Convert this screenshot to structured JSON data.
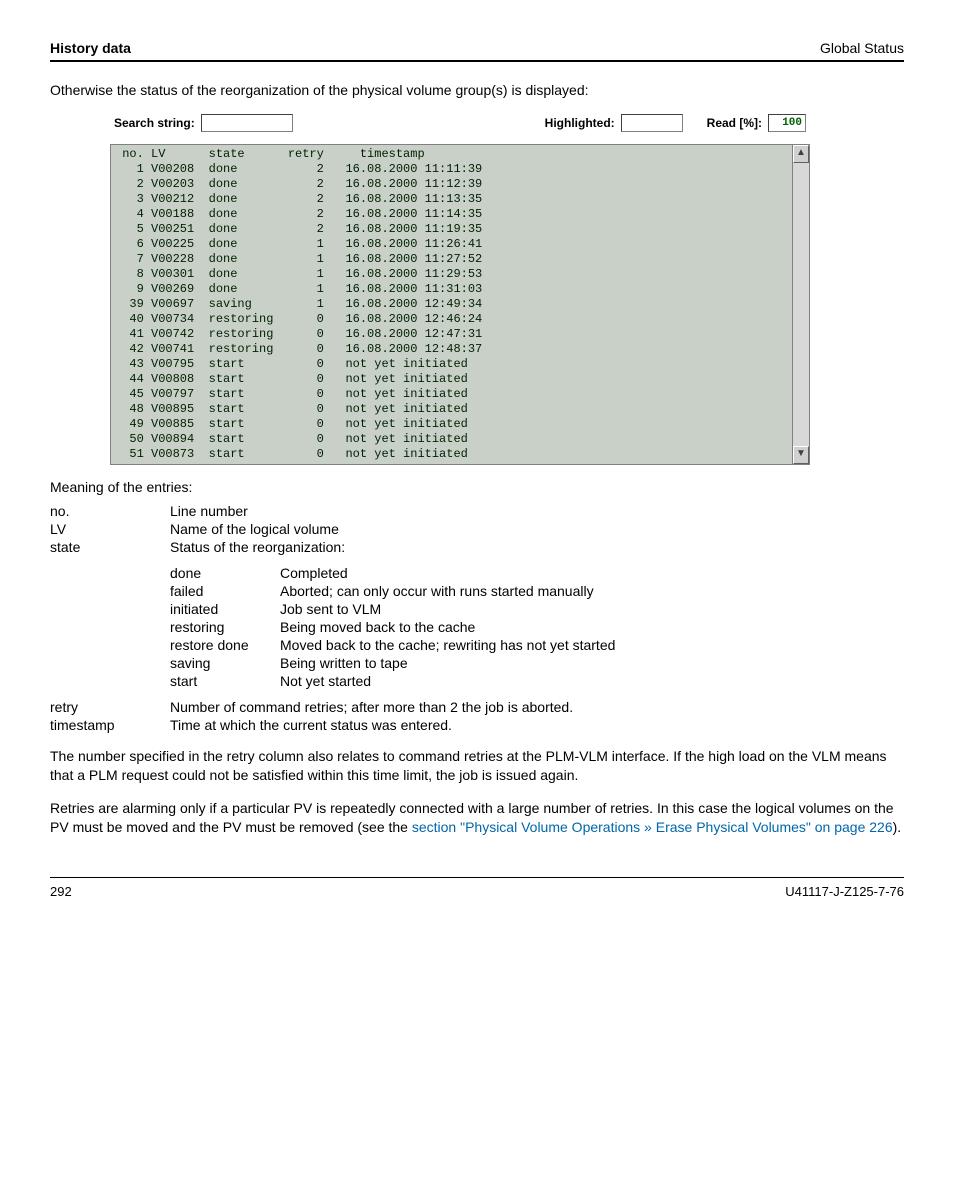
{
  "header": {
    "left": "History data",
    "right": "Global Status"
  },
  "intro": "Otherwise the status of the reorganization of the physical volume group(s) is displayed:",
  "topbar": {
    "search_label": "Search string:",
    "highlighted_label": "Highlighted:",
    "read_label": "Read [%]:",
    "read_value": "100"
  },
  "table": {
    "headers": {
      "no": "no.",
      "lv": "LV",
      "state": "state",
      "retry": "retry",
      "timestamp": "timestamp"
    },
    "rows": [
      {
        "no": "1",
        "lv": "V00208",
        "state": "done",
        "retry": "2",
        "ts": "16.08.2000 11:11:39"
      },
      {
        "no": "2",
        "lv": "V00203",
        "state": "done",
        "retry": "2",
        "ts": "16.08.2000 11:12:39"
      },
      {
        "no": "3",
        "lv": "V00212",
        "state": "done",
        "retry": "2",
        "ts": "16.08.2000 11:13:35"
      },
      {
        "no": "4",
        "lv": "V00188",
        "state": "done",
        "retry": "2",
        "ts": "16.08.2000 11:14:35"
      },
      {
        "no": "5",
        "lv": "V00251",
        "state": "done",
        "retry": "2",
        "ts": "16.08.2000 11:19:35"
      },
      {
        "no": "6",
        "lv": "V00225",
        "state": "done",
        "retry": "1",
        "ts": "16.08.2000 11:26:41"
      },
      {
        "no": "7",
        "lv": "V00228",
        "state": "done",
        "retry": "1",
        "ts": "16.08.2000 11:27:52"
      },
      {
        "no": "8",
        "lv": "V00301",
        "state": "done",
        "retry": "1",
        "ts": "16.08.2000 11:29:53"
      },
      {
        "no": "9",
        "lv": "V00269",
        "state": "done",
        "retry": "1",
        "ts": "16.08.2000 11:31:03"
      },
      {
        "no": "39",
        "lv": "V00697",
        "state": "saving",
        "retry": "1",
        "ts": "16.08.2000 12:49:34"
      },
      {
        "no": "40",
        "lv": "V00734",
        "state": "restoring",
        "retry": "0",
        "ts": "16.08.2000 12:46:24"
      },
      {
        "no": "41",
        "lv": "V00742",
        "state": "restoring",
        "retry": "0",
        "ts": "16.08.2000 12:47:31"
      },
      {
        "no": "42",
        "lv": "V00741",
        "state": "restoring",
        "retry": "0",
        "ts": "16.08.2000 12:48:37"
      },
      {
        "no": "43",
        "lv": "V00795",
        "state": "start",
        "retry": "0",
        "ts": "not yet initiated"
      },
      {
        "no": "44",
        "lv": "V00808",
        "state": "start",
        "retry": "0",
        "ts": "not yet initiated"
      },
      {
        "no": "45",
        "lv": "V00797",
        "state": "start",
        "retry": "0",
        "ts": "not yet initiated"
      },
      {
        "no": "48",
        "lv": "V00895",
        "state": "start",
        "retry": "0",
        "ts": "not yet initiated"
      },
      {
        "no": "49",
        "lv": "V00885",
        "state": "start",
        "retry": "0",
        "ts": "not yet initiated"
      },
      {
        "no": "50",
        "lv": "V00894",
        "state": "start",
        "retry": "0",
        "ts": "not yet initiated"
      },
      {
        "no": "51",
        "lv": "V00873",
        "state": "start",
        "retry": "0",
        "ts": "not yet initiated"
      }
    ]
  },
  "meaning_label": "Meaning of the entries:",
  "defs": {
    "no": {
      "term": "no.",
      "val": "Line number"
    },
    "lv": {
      "term": "LV",
      "val": "Name of the logical volume"
    },
    "state": {
      "term": "state",
      "val": "Status of the reorganization:"
    }
  },
  "states": {
    "done": {
      "t": "done",
      "v": "Completed"
    },
    "failed": {
      "t": "failed",
      "v": "Aborted; can only occur with runs started manually"
    },
    "initiated": {
      "t": "initiated",
      "v": "Job sent to VLM"
    },
    "restoring": {
      "t": "restoring",
      "v": "Being moved back to the cache"
    },
    "restore_done": {
      "t": "restore done",
      "v": "Moved back to the cache; rewriting has not yet started"
    },
    "saving": {
      "t": "saving",
      "v": "Being written to tape"
    },
    "start": {
      "t": "start",
      "v": "Not yet started"
    }
  },
  "defs2": {
    "retry": {
      "term": "retry",
      "val": "Number of command retries; after more than 2 the job is aborted."
    },
    "timestamp": {
      "term": "timestamp",
      "val": "Time at which the current status was entered."
    }
  },
  "para1": "The number specified in the retry column also relates to command retries at the PLM-VLM interface. If the high load on the VLM means that a PLM request could not be satisfied within this time limit, the job is issued again.",
  "para2a": "Retries are alarming only if a particular PV is repeatedly connected with a large number of retries. In this case the logical volumes on the PV must be moved and the PV must be removed (see the ",
  "para2link": "section \"Physical Volume Operations » Erase Physical Volumes\" on page 226",
  "para2b": ").",
  "footer": {
    "left": "292",
    "right": "U41117-J-Z125-7-76"
  }
}
